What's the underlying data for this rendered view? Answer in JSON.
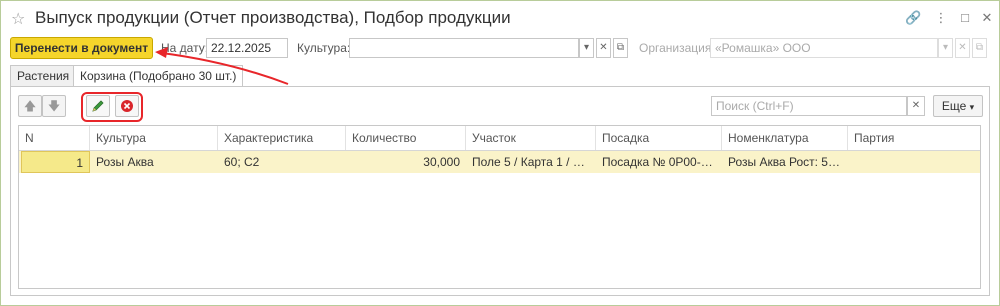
{
  "window": {
    "title": "Выпуск продукции (Отчет производства), Подбор продукции"
  },
  "toolbar": {
    "transfer_label": "Перенести в документ",
    "date_label": "На дату:",
    "date_value": "22.12.2025",
    "culture_label": "Культура:",
    "culture_value": "",
    "org_label": "Организация:",
    "org_value": "«Ромашка» ООО"
  },
  "tabs": [
    {
      "label": "Растения",
      "active": false
    },
    {
      "label": "Корзина (Подобрано 30 шт.)",
      "active": true
    }
  ],
  "panel": {
    "search_placeholder": "Поиск (Ctrl+F)",
    "more_label": "Еще"
  },
  "table": {
    "columns": [
      "N",
      "Культура",
      "Характеристика",
      "Количество",
      "Участок",
      "Посадка",
      "Номенклатура",
      "Партия"
    ],
    "rows": [
      [
        "1",
        "Розы Аква",
        "60; С2",
        "30,000",
        "Поле 5 / Карта 1 / Ря...",
        "Посадка № 0Р00-00...",
        "Розы Аква Рост: 50; ...",
        ""
      ]
    ]
  },
  "colors": {
    "accent_yellow": "#f5d52b",
    "selected_row": "#faf3c9",
    "highlight_red": "#e8262a"
  }
}
